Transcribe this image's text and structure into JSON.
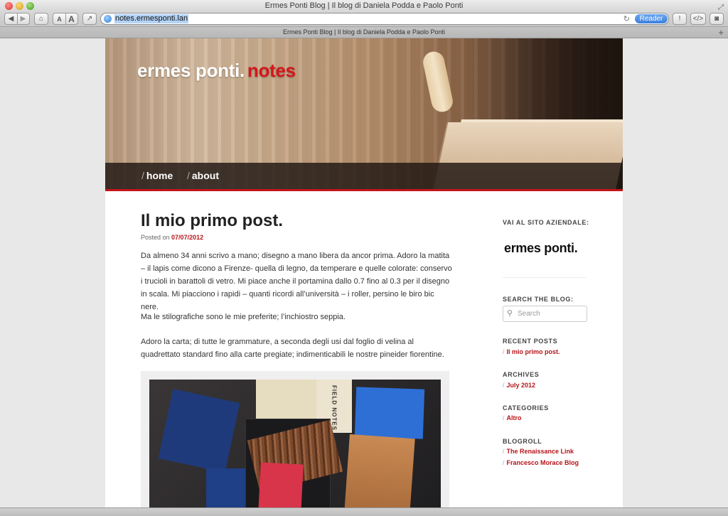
{
  "window": {
    "title": "Ermes Ponti Blog | Il blog di Daniela Podda e Paolo Ponti"
  },
  "toolbar": {
    "font_small": "A",
    "font_large": "A",
    "url": "notes.ermesponti.lan",
    "reader_label": "Reader"
  },
  "tab": {
    "title": "Ermes Ponti Blog | Il blog di Daniela Podda e Paolo Ponti"
  },
  "site": {
    "title_main": "ermes ponti.",
    "title_accent": "notes",
    "nav": [
      {
        "slash": "/",
        "label": "home"
      },
      {
        "slash": "/",
        "label": "about"
      }
    ]
  },
  "post": {
    "title": "Il mio primo post.",
    "posted_on": "Posted on",
    "date": "07/07/2012",
    "paragraphs": [
      "Da almeno 34 anni scrivo a mano; disegno a mano libera da ancor prima. Adoro la matita – il lapis come dicono a Firenze- quella di legno, da temperare e quelle colorate: conservo i trucioli in barattoli di vetro. Mi piace anche il portamina dallo 0.7  fino al 0.3 per il disegno in scala. Mi piacciono i rapidi – quanti ricordi all’università – i roller, persino le biro bic nere.",
      "Ma le stilografiche sono le mie preferite; l’inchiostro seppia.",
      "Adoro la carta; di tutte le grammature, a seconda degli usi dal foglio di velina al quadrettato standard fino alla carte pregiate; indimenticabili le nostre pineider fiorentine."
    ],
    "photo_text": "FIELD NOTES"
  },
  "sidebar": {
    "company_heading": "VAI AL SITO AZIENDALE:",
    "company_logo": "ermes ponti.",
    "search_heading": "SEARCH THE BLOG:",
    "search_placeholder": "Search",
    "recent_heading": "RECENT POSTS",
    "recent": [
      "Il mio primo post."
    ],
    "archives_heading": "ARCHIVES",
    "archives": [
      "July 2012"
    ],
    "categories_heading": "CATEGORIES",
    "categories": [
      "Altro"
    ],
    "blogroll_heading": "BLOGROLL",
    "blogroll": [
      "The Renaissance Link",
      "Francesco Morace Blog"
    ],
    "slash": "/"
  },
  "colors": {
    "accent": "#c2151b",
    "link": "#b5141a"
  },
  "icons": [
    "back-icon",
    "forward-icon",
    "home-icon",
    "share-icon",
    "globe-icon",
    "reload-icon",
    "alert-icon",
    "code-icon",
    "camera-icon",
    "search-icon",
    "new-tab-icon",
    "fullscreen-icon"
  ]
}
